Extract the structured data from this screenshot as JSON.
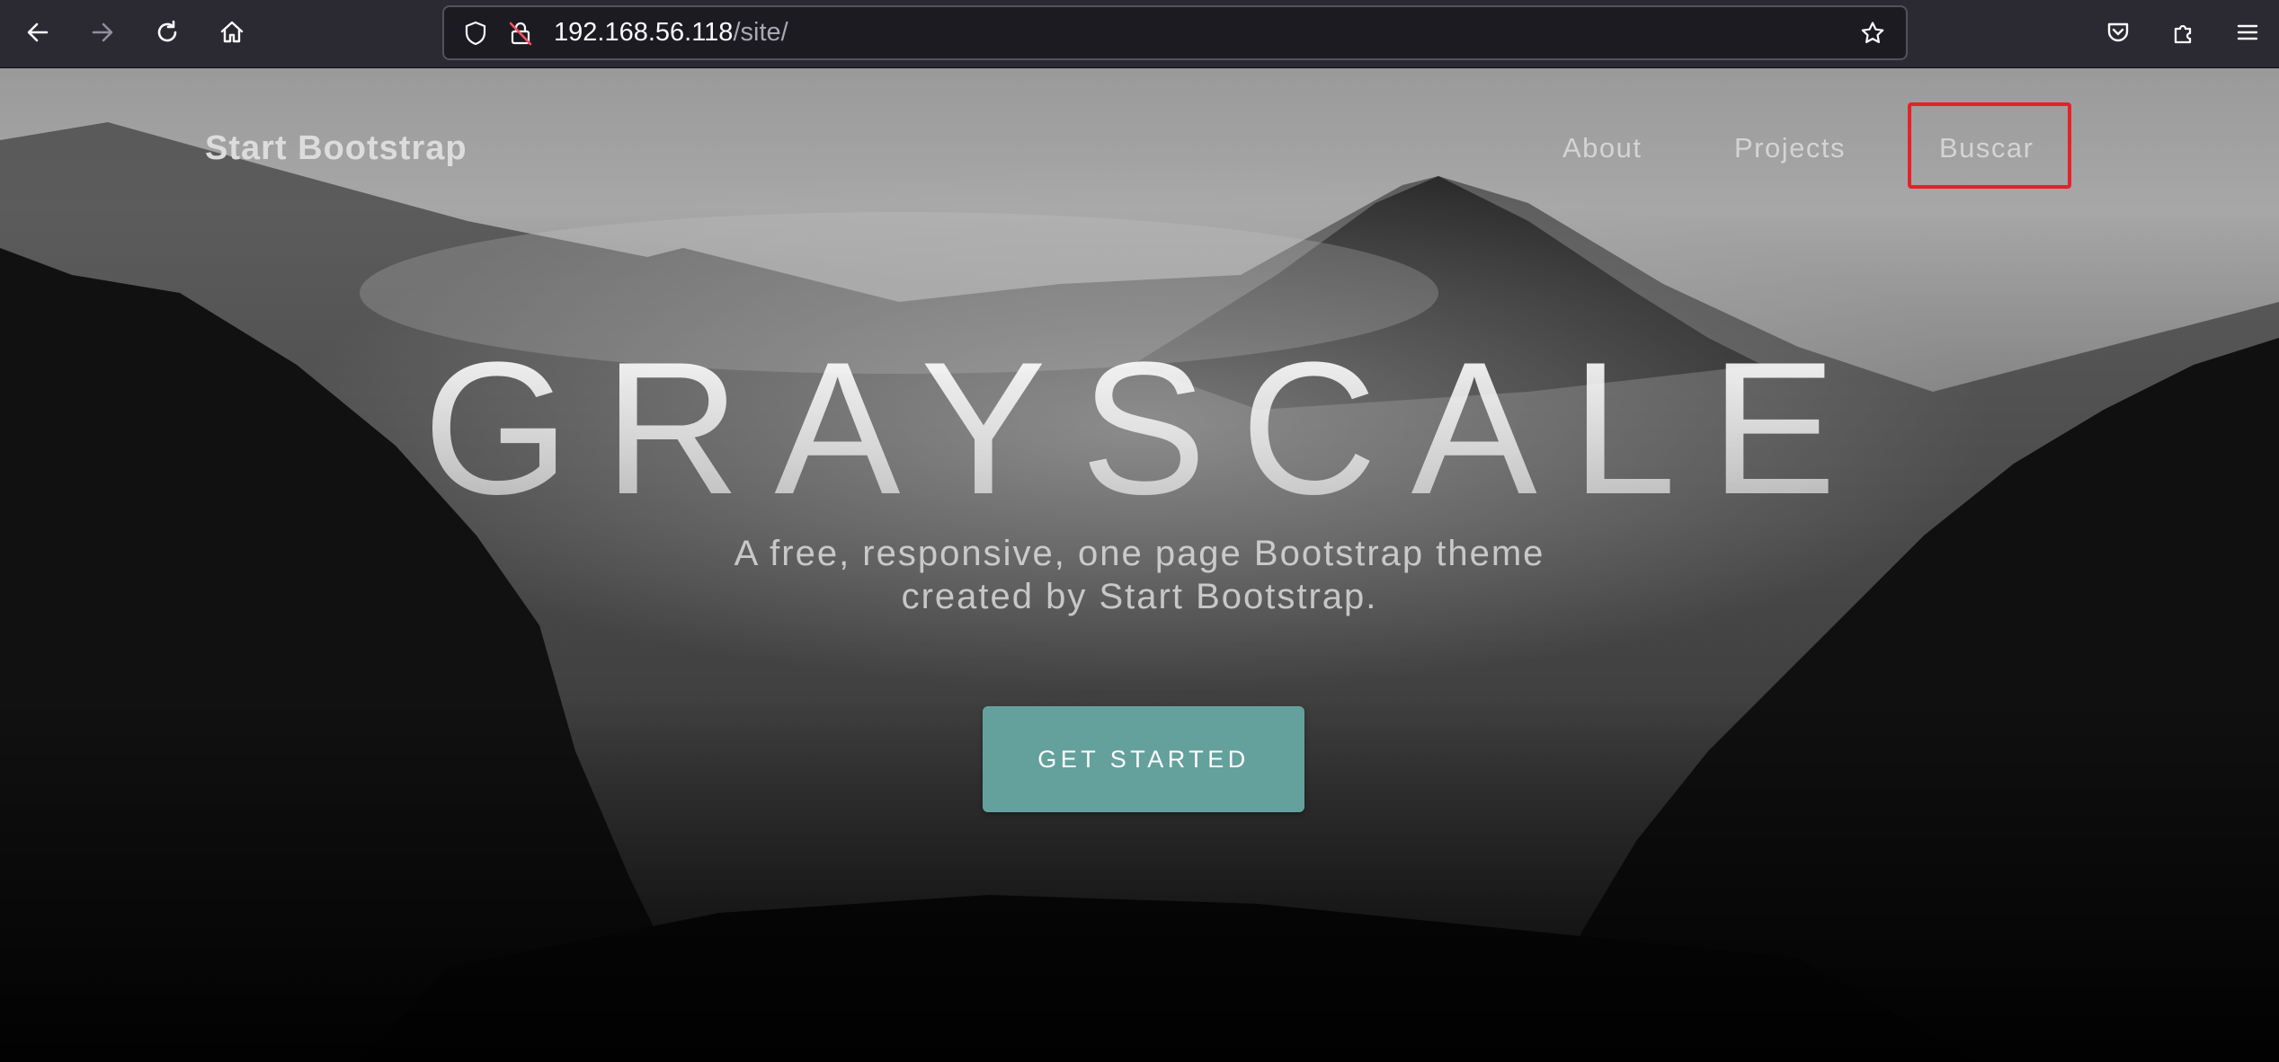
{
  "browser": {
    "url_host": "192.168.56.118",
    "url_path": "/site/",
    "icons": [
      "back-arrow-icon",
      "forward-arrow-icon",
      "reload-icon",
      "home-icon",
      "shield-icon",
      "insecure-lock-icon",
      "bookmark-star-icon",
      "pocket-icon",
      "extensions-icon",
      "menu-icon"
    ]
  },
  "site": {
    "brand": "Start Bootstrap",
    "nav": {
      "about": "About",
      "projects": "Projects",
      "buscar": "Buscar"
    },
    "hero": {
      "title": "GRAYSCALE",
      "subtitle_line1": "A free, responsive, one page Bootstrap theme",
      "subtitle_line2": "created by Start Bootstrap.",
      "cta": "GET STARTED"
    }
  },
  "colors": {
    "chrome_bg": "#2b2a33",
    "urlbar_bg": "#1c1b22",
    "cta_bg": "#64a19d",
    "highlight_box": "#e8202a"
  }
}
